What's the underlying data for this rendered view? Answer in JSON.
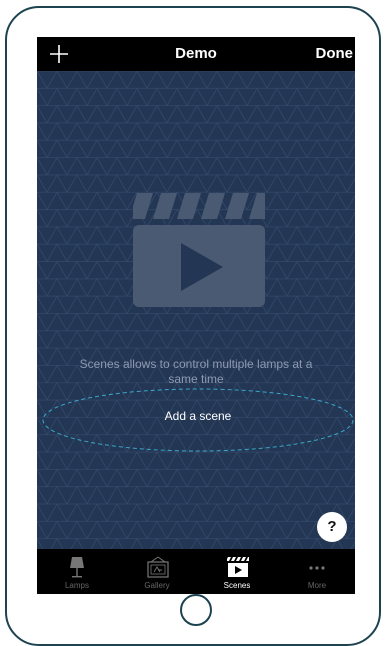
{
  "navbar": {
    "add_icon": "plus-icon",
    "title": "Demo",
    "done_label": "Done"
  },
  "empty_state": {
    "icon": "clapperboard-play-icon",
    "hint": "Scenes allows to control multiple lamps at a same time",
    "add_label": "Add a scene"
  },
  "help_label": "?",
  "tabs": [
    {
      "label": "Lamps",
      "icon": "lamp-icon",
      "active": false
    },
    {
      "label": "Gallery",
      "icon": "gallery-icon",
      "active": false
    },
    {
      "label": "Scenes",
      "icon": "clapperboard-icon",
      "active": true
    },
    {
      "label": "More",
      "icon": "ellipsis-icon",
      "active": false
    }
  ],
  "colors": {
    "screen_bg": "#233654",
    "bar_bg": "#000000",
    "dashed_ellipse": "#3aa8c9",
    "device_outline": "#1d4350"
  }
}
